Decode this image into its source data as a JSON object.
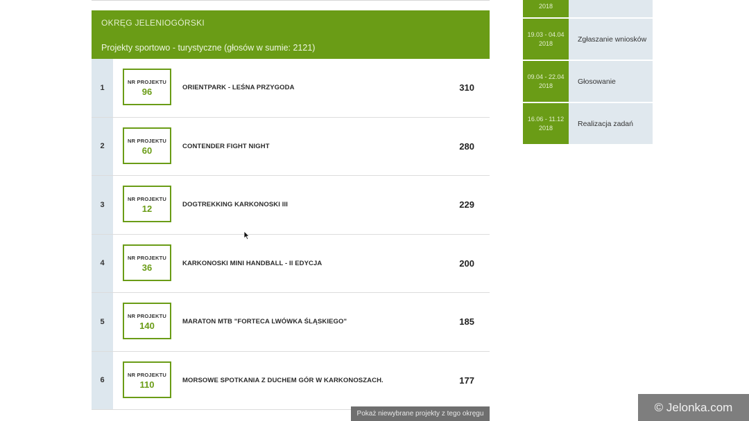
{
  "panel": {
    "district": "OKRĘG JELENIOGÓRSKI",
    "category": "Projekty sportowo - turystyczne (głosów w sumie: 2121)"
  },
  "projects": [
    {
      "rank": "1",
      "label": "NR PROJEKTU",
      "number": "96",
      "title": "ORIENTPARK - LEŚNA PRZYGODA",
      "votes": "310"
    },
    {
      "rank": "2",
      "label": "NR PROJEKTU",
      "number": "60",
      "title": "CONTENDER FIGHT NIGHT",
      "votes": "280"
    },
    {
      "rank": "3",
      "label": "NR PROJEKTU",
      "number": "12",
      "title": "DOGTREKKING KARKONOSKI III",
      "votes": "229"
    },
    {
      "rank": "4",
      "label": "NR PROJEKTU",
      "number": "36",
      "title": "KARKONOSKI MINI HANDBALL - II EDYCJA",
      "votes": "200"
    },
    {
      "rank": "5",
      "label": "NR PROJEKTU",
      "number": "140",
      "title": "MARATON MTB \"FORTECA LWÓWKA ŚLĄSKIEGO\"",
      "votes": "185"
    },
    {
      "rank": "6",
      "label": "NR PROJEKTU",
      "number": "110",
      "title": "MORSOWE SPOTKANIA Z DUCHEM GÓR W KARKONOSZACH.",
      "votes": "177"
    }
  ],
  "show_button": "Pokaż niewybrane projekty z tego okręgu",
  "timeline": [
    {
      "date": "2018",
      "label": ""
    },
    {
      "date": "19.03 - 04.04 2018",
      "label": "Zgłaszanie wniosków"
    },
    {
      "date": "09.04 - 22.04 2018",
      "label": "Głosowanie"
    },
    {
      "date": "16.06 - 11.12 2018",
      "label": "Realizacja zadań"
    }
  ],
  "watermark": "© Jelonka.com",
  "colors": {
    "accent": "#6a9c16",
    "rank_bg": "#dde7ee",
    "button": "#6f6f6f"
  }
}
